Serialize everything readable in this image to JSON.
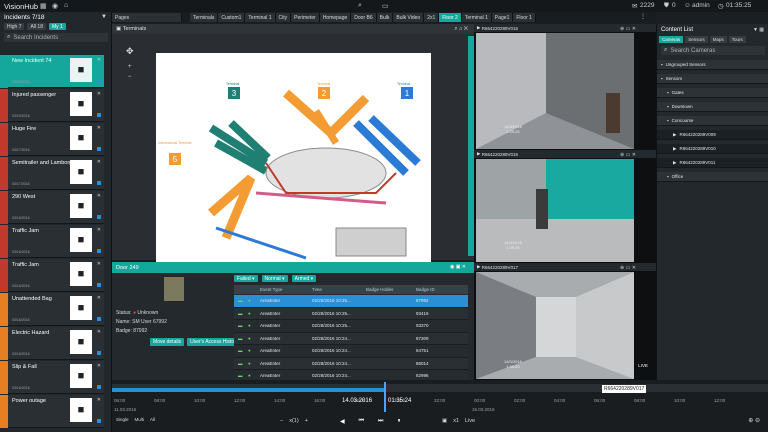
{
  "app": {
    "title": "VisionHub"
  },
  "topbar": {
    "counter": "2229",
    "shield": "0",
    "user": "admin",
    "time": "01:35:25"
  },
  "incidents": {
    "header": "Incidents 7/18",
    "filters": [
      "High",
      "All",
      "My"
    ],
    "filter_counts": [
      "7",
      "18",
      "1"
    ],
    "search_placeholder": "Search Incidents",
    "items": [
      {
        "title": "New Incident 74",
        "date": "03/28/2016",
        "icon": "clipboard-icon",
        "stripe": "#13a89b"
      },
      {
        "title": "Injured passenger",
        "date": "03/19/2016",
        "icon": "person-icon",
        "stripe": "#c0392b"
      },
      {
        "title": "Huge Fire",
        "date": "03/17/2016",
        "icon": "fire-icon",
        "stripe": "#c0392b"
      },
      {
        "title": "Semitrailer and Lamborghini",
        "date": "03/17/2016",
        "icon": "car-crash-icon",
        "stripe": "#c0392b"
      },
      {
        "title": "290 West",
        "date": "03/16/2016",
        "icon": "no-entry-icon",
        "stripe": "#c0392b"
      },
      {
        "title": "Traffic Jam",
        "date": "03/16/2016",
        "icon": "no-car-icon",
        "stripe": "#c0392b"
      },
      {
        "title": "Traffic Jam",
        "date": "03/16/2016",
        "icon": "no-car-icon",
        "stripe": "#c0392b"
      },
      {
        "title": "Unattended Bag",
        "date": "03/16/2016",
        "icon": "bag-icon",
        "stripe": "#e67e22"
      },
      {
        "title": "Electric Hazard",
        "date": "03/16/2016",
        "icon": "biohazard-icon",
        "stripe": "#e67e22"
      },
      {
        "title": "Slip & Fall",
        "date": "03/16/2016",
        "icon": "person-icon",
        "stripe": "#e67e22"
      },
      {
        "title": "Power outage",
        "date": "",
        "icon": "warning-icon",
        "stripe": "#e67e22"
      }
    ]
  },
  "tabs": {
    "pages_label": "Pages",
    "items": [
      "Terminals",
      "Custom1",
      "Terminal 1",
      "City",
      "Perimeter",
      "Homepage",
      "Door B6",
      "Bulk",
      "Bulk Video",
      "2x1",
      "Floor 2",
      "Terminal 1",
      "Page1",
      "Floor 1"
    ],
    "active_index": 10
  },
  "map": {
    "title": "Terminals",
    "terminals": [
      {
        "label": "Terminal",
        "num": "3",
        "color": "#1e7f72"
      },
      {
        "label": "Terminal",
        "num": "2",
        "color": "#f39c33"
      },
      {
        "label": "Terminal",
        "num": "1",
        "color": "#2b7bd6"
      },
      {
        "label": "International Terminal",
        "num": "5",
        "color": "#f39c33"
      }
    ]
  },
  "door": {
    "title": "Door 249",
    "status_label": "Status:",
    "status": "Unknown",
    "name_label": "Name:",
    "name": "SM User 67992",
    "badge_label": "Badge:",
    "badge": "87992",
    "buttons": [
      "Move details",
      "User's Access History"
    ],
    "filters": [
      "Failed",
      "Normal",
      "Armed"
    ],
    "columns": [
      "Event Type",
      "Time",
      "Badge Holder",
      "Badge ID"
    ],
    "rows": [
      {
        "type": "AreaEnter",
        "time": "02/28/2016 10:25...",
        "id": "87992"
      },
      {
        "type": "AreaEnter",
        "time": "02/28/2016 10:25...",
        "id": "93416"
      },
      {
        "type": "AreaEnter",
        "time": "02/28/2016 10:25...",
        "id": "93370"
      },
      {
        "type": "AreaEnter",
        "time": "02/28/2016 10:24...",
        "id": "87309"
      },
      {
        "type": "AreaEnter",
        "time": "02/28/2016 10:24...",
        "id": "84751"
      },
      {
        "type": "AreaEnter",
        "time": "02/28/2016 10:24...",
        "id": "86014"
      },
      {
        "type": "AreaEnter",
        "time": "02/28/2016 10:24...",
        "id": "82996"
      }
    ]
  },
  "cameras": [
    {
      "name": "R664220289V015",
      "date": "14/3/2016",
      "time": "1:35:25"
    },
    {
      "name": "R664220289V016",
      "date": "14/3/2016",
      "time": "1:35:25"
    },
    {
      "name": "R664220289V017",
      "date": "14/3/2016",
      "time": "1:35:25",
      "live": "LIVE"
    }
  ],
  "content_list": {
    "title": "Content List",
    "tabs": [
      "Cameras",
      "Sensors",
      "Maps",
      "Tours"
    ],
    "search_placeholder": "Search Cameras",
    "tree": [
      {
        "label": "Ungrouped Sensors",
        "level": 0
      },
      {
        "label": "Sensors",
        "level": 0
      },
      {
        "label": "Gates",
        "level": 1
      },
      {
        "label": "Downtown",
        "level": 1
      },
      {
        "label": "Concourse",
        "level": 1
      },
      {
        "label": "R664220289V009",
        "level": 2
      },
      {
        "label": "R664220289V010",
        "level": 2
      },
      {
        "label": "R664220289V011",
        "level": 2
      },
      {
        "label": "Office",
        "level": 1
      }
    ]
  },
  "timeline": {
    "ticks": [
      "06:00",
      "08:00",
      "10:00",
      "12:00",
      "14:00",
      "16:00",
      "18:00",
      "20:00",
      "22:00",
      "00:00",
      "02:00",
      "04:00",
      "06:00",
      "08:00",
      "10:00",
      "12:00"
    ],
    "date_left": "11.03.2016",
    "date_center": "14.03.2016",
    "time_center": "01:35:24",
    "date_right": "15.03.2016",
    "camera_tag": "R664220289V017",
    "modes": [
      "Single",
      "Multi",
      "All"
    ],
    "speed": "x(1)",
    "speed_right": "x1",
    "live": "Live"
  }
}
